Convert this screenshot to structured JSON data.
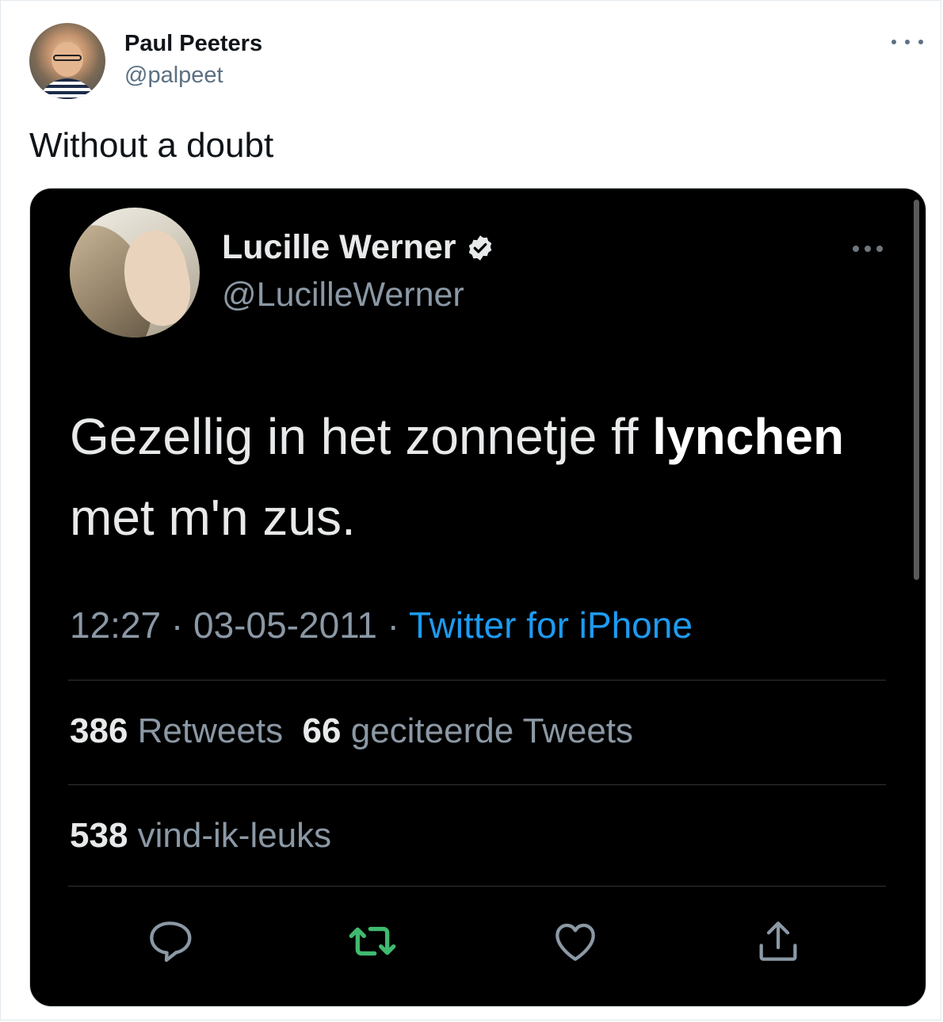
{
  "tweet": {
    "author_name": "Paul Peeters",
    "author_handle": "@palpeet",
    "text": "Without a doubt"
  },
  "embedded_tweet": {
    "author_name": "Lucille Werner",
    "author_handle": "@LucilleWerner",
    "text_before": "Gezellig in het zonnetje ff ",
    "text_bold": "lynchen",
    "text_after": " met m'n zus.",
    "time": "12:27",
    "date": "03-05-2011",
    "separator": " · ",
    "client": "Twitter for iPhone",
    "retweets_count": "386",
    "retweets_label": "Retweets",
    "quotes_count": "66",
    "quotes_label": "geciteerde Tweets",
    "likes_count": "538",
    "likes_label": "vind-ik-leuks"
  },
  "icons": {
    "reply": "reply-icon",
    "retweet": "retweet-icon",
    "like": "heart-icon",
    "share": "share-icon",
    "verified": "verified-badge-icon",
    "more": "more-icon"
  },
  "colors": {
    "link_blue": "#1d9bf0",
    "retweet_green": "#3fba6f"
  }
}
